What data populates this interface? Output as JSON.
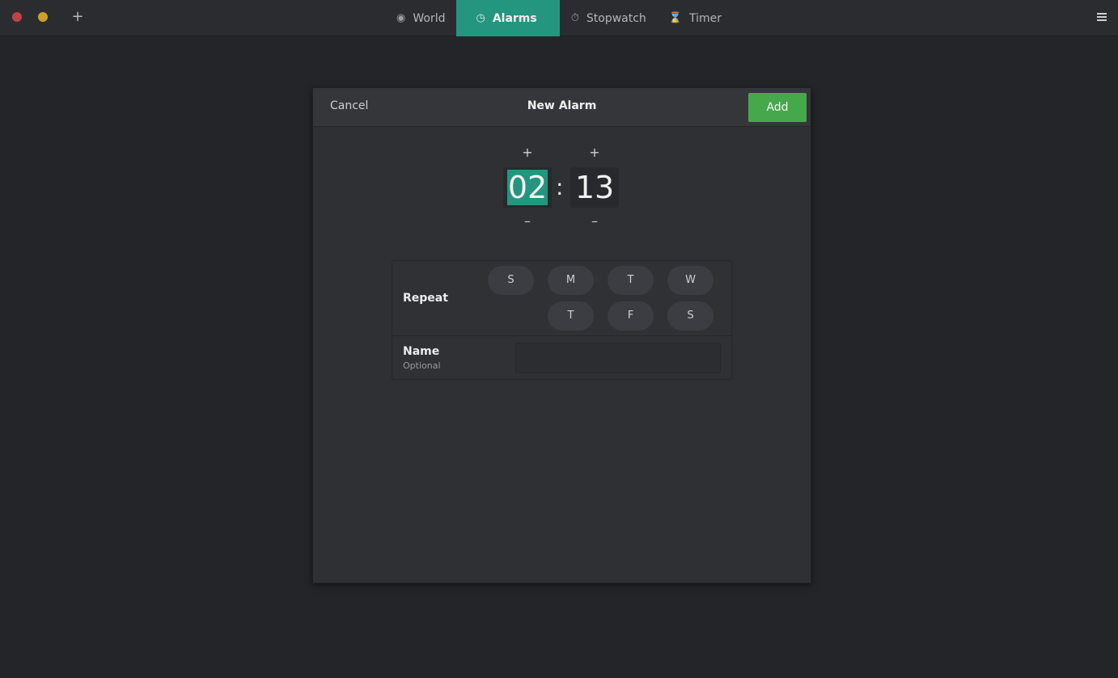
{
  "titlebar": {
    "new_tab_label": "+"
  },
  "tabs": [
    {
      "label": "World",
      "icon": "globe-icon"
    },
    {
      "label": "Alarms",
      "icon": "clock-icon",
      "active": true
    },
    {
      "label": "Stopwatch",
      "icon": "stopwatch-icon"
    },
    {
      "label": "Timer",
      "icon": "hourglass-icon"
    }
  ],
  "dialog": {
    "cancel_label": "Cancel",
    "title": "New Alarm",
    "add_label": "Add",
    "hours": "02",
    "minutes": "13",
    "separator": ":",
    "plus": "+",
    "minus": "–",
    "repeat_label": "Repeat",
    "days": [
      "S",
      "M",
      "T",
      "W",
      "T",
      "F",
      "S"
    ],
    "name_label": "Name",
    "name_sublabel": "Optional",
    "name_value": ""
  },
  "colors": {
    "accent": "#24957f",
    "add_button": "#45a84a",
    "close_dot": "#c0414a",
    "minimize_dot": "#c9a12a"
  }
}
